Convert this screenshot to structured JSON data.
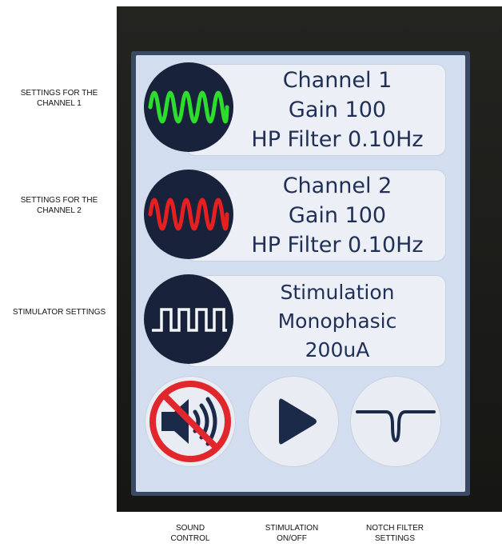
{
  "side_labels": {
    "channel1": "SETTINGS FOR THE\nCHANNEL 1",
    "channel2": "SETTINGS FOR THE\nCHANNEL 2",
    "stimulator": "STIMULATOR SETTINGS"
  },
  "bottom_labels": {
    "sound": "SOUND\nCONTROL",
    "stimulation": "STIMULATION\nON/OFF",
    "notch": "NOTCH FILTER\nSETTINGS"
  },
  "channel1": {
    "title": "Channel 1",
    "gain": "Gain 100",
    "filter": "HP Filter 0.10Hz",
    "icon": "green-sine-wave-icon",
    "color": "#2edc2e"
  },
  "channel2": {
    "title": "Channel 2",
    "gain": "Gain 100",
    "filter": "HP Filter 0.10Hz",
    "icon": "red-sine-wave-icon",
    "color": "#e62020"
  },
  "stimulation": {
    "title": "Stimulation",
    "mode": "Monophasic",
    "current": "200uA",
    "icon": "square-pulse-icon"
  },
  "buttons": {
    "sound": "muted-speaker-icon",
    "play": "play-icon",
    "notch": "notch-filter-icon"
  },
  "colors": {
    "screen_bg": "#d2def0",
    "card_bg": "#eceff6",
    "text": "#1f2f55",
    "icon_circle": "#18223a",
    "mute_red": "#e1262c"
  }
}
